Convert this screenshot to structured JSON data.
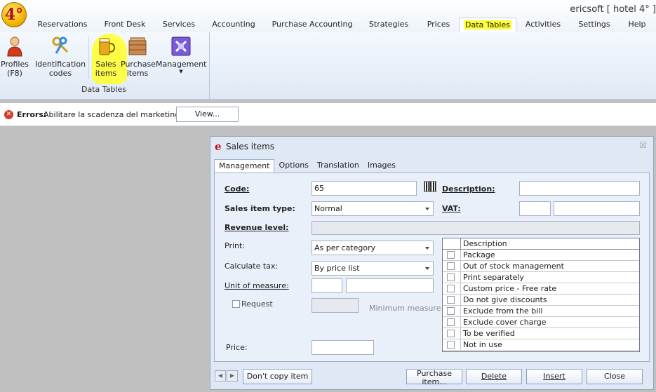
{
  "window": {
    "title": "ericsoft [ hotel 4° ]",
    "logo_text": "4°"
  },
  "menu_tabs": [
    {
      "label": "Reservations"
    },
    {
      "label": "Front Desk"
    },
    {
      "label": "Services"
    },
    {
      "label": "Accounting"
    },
    {
      "label": "Purchase Accounting"
    },
    {
      "label": "Strategies"
    },
    {
      "label": "Prices"
    },
    {
      "label": "Data Tables"
    },
    {
      "label": "Activities"
    },
    {
      "label": "Settings"
    },
    {
      "label": "Help"
    }
  ],
  "ribbon": {
    "group_label": "Data Tables",
    "buttons": [
      {
        "label_line1": "Profiles",
        "label_line2": "(F8)"
      },
      {
        "label_line1": "Identification",
        "label_line2": "codes"
      },
      {
        "label_line1": "Sales",
        "label_line2": "items"
      },
      {
        "label_line1": "Purchase",
        "label_line2": "items"
      },
      {
        "label_line1": "Management",
        "label_line2": ""
      }
    ]
  },
  "errors": {
    "label": "Errors:",
    "message": "Abilitare la scadenza del marketing*",
    "view_button": "View..."
  },
  "dialog": {
    "logo": "e",
    "title": "Sales items",
    "close_glyph": "☒",
    "tabs": [
      {
        "label": "Management"
      },
      {
        "label": "Options"
      },
      {
        "label": "Translation"
      },
      {
        "label": "Images"
      }
    ],
    "form": {
      "code_label": "Code:",
      "code_value": "65",
      "description_label": "Description:",
      "description_value": "",
      "sales_item_type_label": "Sales item type:",
      "sales_item_type_value": "Normal",
      "vat_label": "VAT:",
      "revenue_level_label": "Revenue level:",
      "print_label": "Print:",
      "print_value": "As per category",
      "calculate_tax_label": "Calculate tax:",
      "calculate_tax_value": "By price list",
      "unit_of_measure_label": "Unit of measure:",
      "request_label": "Request",
      "minimum_measure_label": "Minimum measure:",
      "price_label": "Price:"
    },
    "options_grid": {
      "header": "Description",
      "rows": [
        {
          "label": "Package"
        },
        {
          "label": "Out of stock management"
        },
        {
          "label": "Print separately"
        },
        {
          "label": "Custom price - Free rate"
        },
        {
          "label": "Do not give discounts"
        },
        {
          "label": "Exclude from the bill"
        },
        {
          "label": "Exclude cover charge"
        },
        {
          "label": "To be verified"
        },
        {
          "label": "Not in use"
        }
      ]
    },
    "buttons": {
      "dont_copy": "Don't copy item",
      "purchase_line1": "Purchase",
      "purchase_line2": "item...",
      "delete": "Delete",
      "insert": "Insert",
      "close": "Close"
    }
  },
  "colors": {
    "accent_highlight": "#ffff33",
    "error_red": "#d63a2a",
    "brand_red": "#c01010"
  }
}
